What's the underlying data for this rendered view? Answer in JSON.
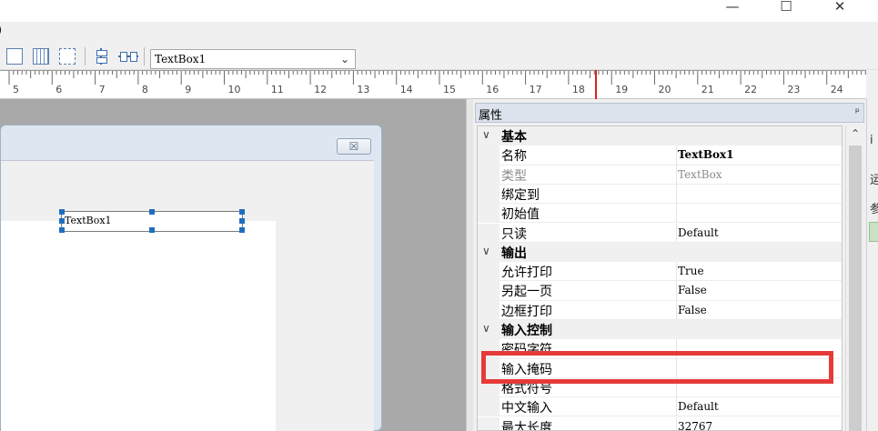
{
  "window": {
    "minimize_glyph": "—",
    "maximize_glyph": "☐",
    "close_glyph": "✕"
  },
  "menu": {
    "fragment": ")"
  },
  "toolbar": {
    "control_select_value": "TextBox1",
    "icons": [
      "align-icon",
      "grid-icon",
      "select-icon",
      "vertical-spacing-icon",
      "horizontal-spacing-icon"
    ]
  },
  "ruler": {
    "labels": [
      "5",
      "6",
      "7",
      "8",
      "9",
      "10",
      "11",
      "12",
      "13",
      "14",
      "15",
      "16",
      "17",
      "18",
      "19",
      "20",
      "21",
      "22",
      "23",
      "24"
    ],
    "marker_color": "#e02020"
  },
  "designer": {
    "textbox_text": "TextBox1",
    "dialog_close_glyph": "☒"
  },
  "properties": {
    "title": "属性",
    "pin_glyph": "ᵖ",
    "rows": [
      {
        "type": "cat",
        "name": "基本"
      },
      {
        "type": "prop",
        "name": "名称",
        "value": "TextBox1",
        "bold": true
      },
      {
        "type": "prop",
        "name": "类型",
        "value": "TextBox",
        "disabled": true
      },
      {
        "type": "prop",
        "name": "绑定到",
        "value": ""
      },
      {
        "type": "prop",
        "name": "初始值",
        "value": ""
      },
      {
        "type": "prop",
        "name": "只读",
        "value": "Default"
      },
      {
        "type": "cat",
        "name": "输出"
      },
      {
        "type": "prop",
        "name": "允许打印",
        "value": "True"
      },
      {
        "type": "prop",
        "name": "另起一页",
        "value": "False"
      },
      {
        "type": "prop",
        "name": "边框打印",
        "value": "False"
      },
      {
        "type": "cat",
        "name": "输入控制"
      },
      {
        "type": "prop",
        "name": "密码字符",
        "value": ""
      },
      {
        "type": "prop",
        "name": "输入掩码",
        "value": ""
      },
      {
        "type": "prop",
        "name": "格式符号",
        "value": ""
      },
      {
        "type": "prop",
        "name": "中文输入",
        "value": "Default"
      },
      {
        "type": "prop",
        "name": "最大长度",
        "value": "32767"
      }
    ],
    "highlight_color": "#e63a3a"
  },
  "far_right": {
    "chars": [
      "i",
      "运",
      "参"
    ]
  }
}
